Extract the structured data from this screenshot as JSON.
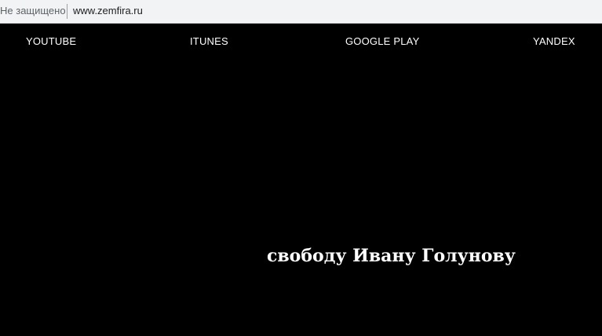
{
  "browser": {
    "security_label": "Не защищено",
    "url": "www.zemfira.ru"
  },
  "nav": {
    "links": [
      {
        "label": "YOUTUBE"
      },
      {
        "label": "ITUNES"
      },
      {
        "label": "GOOGLE PLAY"
      },
      {
        "label": "YANDEX"
      }
    ]
  },
  "main": {
    "headline": "свободу Ивану Голунову"
  },
  "colors": {
    "background": "#000000",
    "text": "#ffffff"
  }
}
